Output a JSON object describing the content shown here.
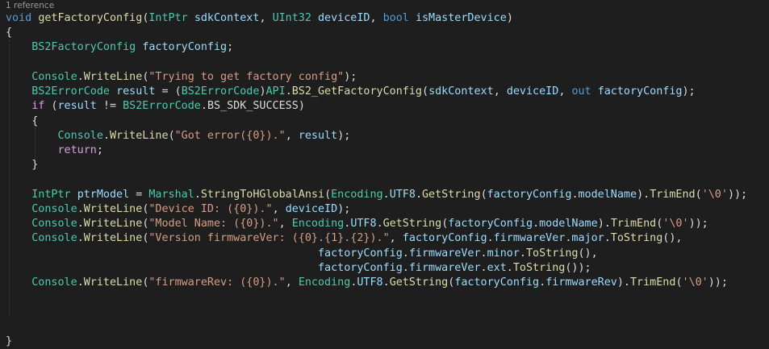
{
  "codelens": "1 reference",
  "colors": {
    "background": "#1e1e1e",
    "keyword": "#569cd6",
    "type": "#4ec9b0",
    "method": "#dcdcaa",
    "string": "#d69d85",
    "variable": "#9cdcfe",
    "control": "#d8a0df",
    "plain": "#dcdcdc",
    "codelens": "#999999"
  },
  "lines": [
    [
      [
        "void",
        "kw"
      ],
      [
        " ",
        "p"
      ],
      [
        "getFactoryConfig",
        "fn"
      ],
      [
        "(",
        "p"
      ],
      [
        "IntPtr",
        "ty"
      ],
      [
        " ",
        "p"
      ],
      [
        "sdkContext",
        "var"
      ],
      [
        ", ",
        "p"
      ],
      [
        "UInt32",
        "ty"
      ],
      [
        " ",
        "p"
      ],
      [
        "deviceID",
        "var"
      ],
      [
        ", ",
        "p"
      ],
      [
        "bool",
        "kw"
      ],
      [
        " ",
        "p"
      ],
      [
        "isMasterDevice",
        "var"
      ],
      [
        ")",
        "p"
      ]
    ],
    [
      [
        "{",
        "p"
      ]
    ],
    [
      [
        "    ",
        "p"
      ],
      [
        "BS2FactoryConfig",
        "ty"
      ],
      [
        " ",
        "p"
      ],
      [
        "factoryConfig",
        "var"
      ],
      [
        ";",
        "p"
      ]
    ],
    [],
    [
      [
        "    ",
        "p"
      ],
      [
        "Console",
        "ty"
      ],
      [
        ".",
        "p"
      ],
      [
        "WriteLine",
        "fn"
      ],
      [
        "(",
        "p"
      ],
      [
        "\"Trying to get factory config\"",
        "str"
      ],
      [
        ");",
        "p"
      ]
    ],
    [
      [
        "    ",
        "p"
      ],
      [
        "BS2ErrorCode",
        "ty"
      ],
      [
        " ",
        "p"
      ],
      [
        "result",
        "var"
      ],
      [
        " = (",
        "p"
      ],
      [
        "BS2ErrorCode",
        "ty"
      ],
      [
        ")",
        "p"
      ],
      [
        "API",
        "ty"
      ],
      [
        ".",
        "p"
      ],
      [
        "BS2_GetFactoryConfig",
        "fn"
      ],
      [
        "(",
        "p"
      ],
      [
        "sdkContext",
        "var"
      ],
      [
        ", ",
        "p"
      ],
      [
        "deviceID",
        "var"
      ],
      [
        ", ",
        "p"
      ],
      [
        "out",
        "kw"
      ],
      [
        " ",
        "p"
      ],
      [
        "factoryConfig",
        "var"
      ],
      [
        ");",
        "p"
      ]
    ],
    [
      [
        "    ",
        "p"
      ],
      [
        "if",
        "ctl"
      ],
      [
        " (",
        "p"
      ],
      [
        "result",
        "var"
      ],
      [
        " != ",
        "p"
      ],
      [
        "BS2ErrorCode",
        "ty"
      ],
      [
        ".",
        "p"
      ],
      [
        "BS_SDK_SUCCESS",
        "p"
      ],
      [
        ")",
        "p"
      ]
    ],
    [
      [
        "    ",
        "p"
      ],
      [
        "{",
        "p"
      ]
    ],
    [
      [
        "        ",
        "p"
      ],
      [
        "Console",
        "ty"
      ],
      [
        ".",
        "p"
      ],
      [
        "WriteLine",
        "fn"
      ],
      [
        "(",
        "p"
      ],
      [
        "\"Got error({0}).\"",
        "str"
      ],
      [
        ", ",
        "p"
      ],
      [
        "result",
        "var"
      ],
      [
        ");",
        "p"
      ]
    ],
    [
      [
        "        ",
        "p"
      ],
      [
        "return",
        "ctl"
      ],
      [
        ";",
        "p"
      ]
    ],
    [
      [
        "    ",
        "p"
      ],
      [
        "}",
        "p"
      ]
    ],
    [],
    [
      [
        "    ",
        "p"
      ],
      [
        "IntPtr",
        "ty"
      ],
      [
        " ",
        "p"
      ],
      [
        "ptrModel",
        "var"
      ],
      [
        " = ",
        "p"
      ],
      [
        "Marshal",
        "ty"
      ],
      [
        ".",
        "p"
      ],
      [
        "StringToHGlobalAnsi",
        "fn"
      ],
      [
        "(",
        "p"
      ],
      [
        "Encoding",
        "ty"
      ],
      [
        ".",
        "p"
      ],
      [
        "UTF8",
        "var"
      ],
      [
        ".",
        "p"
      ],
      [
        "GetString",
        "fn"
      ],
      [
        "(",
        "p"
      ],
      [
        "factoryConfig",
        "var"
      ],
      [
        ".",
        "p"
      ],
      [
        "modelName",
        "var"
      ],
      [
        ").",
        "p"
      ],
      [
        "TrimEnd",
        "fn"
      ],
      [
        "(",
        "p"
      ],
      [
        "'\\0'",
        "str"
      ],
      [
        "));",
        "p"
      ]
    ],
    [
      [
        "    ",
        "p"
      ],
      [
        "Console",
        "ty"
      ],
      [
        ".",
        "p"
      ],
      [
        "WriteLine",
        "fn"
      ],
      [
        "(",
        "p"
      ],
      [
        "\"Device ID: ({0}).\"",
        "str"
      ],
      [
        ", ",
        "p"
      ],
      [
        "deviceID",
        "var"
      ],
      [
        ");",
        "p"
      ]
    ],
    [
      [
        "    ",
        "p"
      ],
      [
        "Console",
        "ty"
      ],
      [
        ".",
        "p"
      ],
      [
        "WriteLine",
        "fn"
      ],
      [
        "(",
        "p"
      ],
      [
        "\"Model Name: ({0}).\"",
        "str"
      ],
      [
        ", ",
        "p"
      ],
      [
        "Encoding",
        "ty"
      ],
      [
        ".",
        "p"
      ],
      [
        "UTF8",
        "var"
      ],
      [
        ".",
        "p"
      ],
      [
        "GetString",
        "fn"
      ],
      [
        "(",
        "p"
      ],
      [
        "factoryConfig",
        "var"
      ],
      [
        ".",
        "p"
      ],
      [
        "modelName",
        "var"
      ],
      [
        ").",
        "p"
      ],
      [
        "TrimEnd",
        "fn"
      ],
      [
        "(",
        "p"
      ],
      [
        "'\\0'",
        "str"
      ],
      [
        "));",
        "p"
      ]
    ],
    [
      [
        "    ",
        "p"
      ],
      [
        "Console",
        "ty"
      ],
      [
        ".",
        "p"
      ],
      [
        "WriteLine",
        "fn"
      ],
      [
        "(",
        "p"
      ],
      [
        "\"Version firmwareVer: ({0}.{1}.{2}).\"",
        "str"
      ],
      [
        ", ",
        "p"
      ],
      [
        "factoryConfig",
        "var"
      ],
      [
        ".",
        "p"
      ],
      [
        "firmwareVer",
        "var"
      ],
      [
        ".",
        "p"
      ],
      [
        "major",
        "var"
      ],
      [
        ".",
        "p"
      ],
      [
        "ToString",
        "fn"
      ],
      [
        "(),",
        "p"
      ]
    ],
    [
      [
        "                                                ",
        "p"
      ],
      [
        "factoryConfig",
        "var"
      ],
      [
        ".",
        "p"
      ],
      [
        "firmwareVer",
        "var"
      ],
      [
        ".",
        "p"
      ],
      [
        "minor",
        "var"
      ],
      [
        ".",
        "p"
      ],
      [
        "ToString",
        "fn"
      ],
      [
        "(),",
        "p"
      ]
    ],
    [
      [
        "                                                ",
        "p"
      ],
      [
        "factoryConfig",
        "var"
      ],
      [
        ".",
        "p"
      ],
      [
        "firmwareVer",
        "var"
      ],
      [
        ".",
        "p"
      ],
      [
        "ext",
        "var"
      ],
      [
        ".",
        "p"
      ],
      [
        "ToString",
        "fn"
      ],
      [
        "());",
        "p"
      ]
    ],
    [
      [
        "    ",
        "p"
      ],
      [
        "Console",
        "ty"
      ],
      [
        ".",
        "p"
      ],
      [
        "WriteLine",
        "fn"
      ],
      [
        "(",
        "p"
      ],
      [
        "\"firmwareRev: ({0}).\"",
        "str"
      ],
      [
        ", ",
        "p"
      ],
      [
        "Encoding",
        "ty"
      ],
      [
        ".",
        "p"
      ],
      [
        "UTF8",
        "var"
      ],
      [
        ".",
        "p"
      ],
      [
        "GetString",
        "fn"
      ],
      [
        "(",
        "p"
      ],
      [
        "factoryConfig",
        "var"
      ],
      [
        ".",
        "p"
      ],
      [
        "firmwareRev",
        "var"
      ],
      [
        ").",
        "p"
      ],
      [
        "TrimEnd",
        "fn"
      ],
      [
        "(",
        "p"
      ],
      [
        "'\\0'",
        "str"
      ],
      [
        "));",
        "p"
      ]
    ],
    [],
    [],
    [],
    [
      [
        "}",
        "p"
      ]
    ]
  ]
}
